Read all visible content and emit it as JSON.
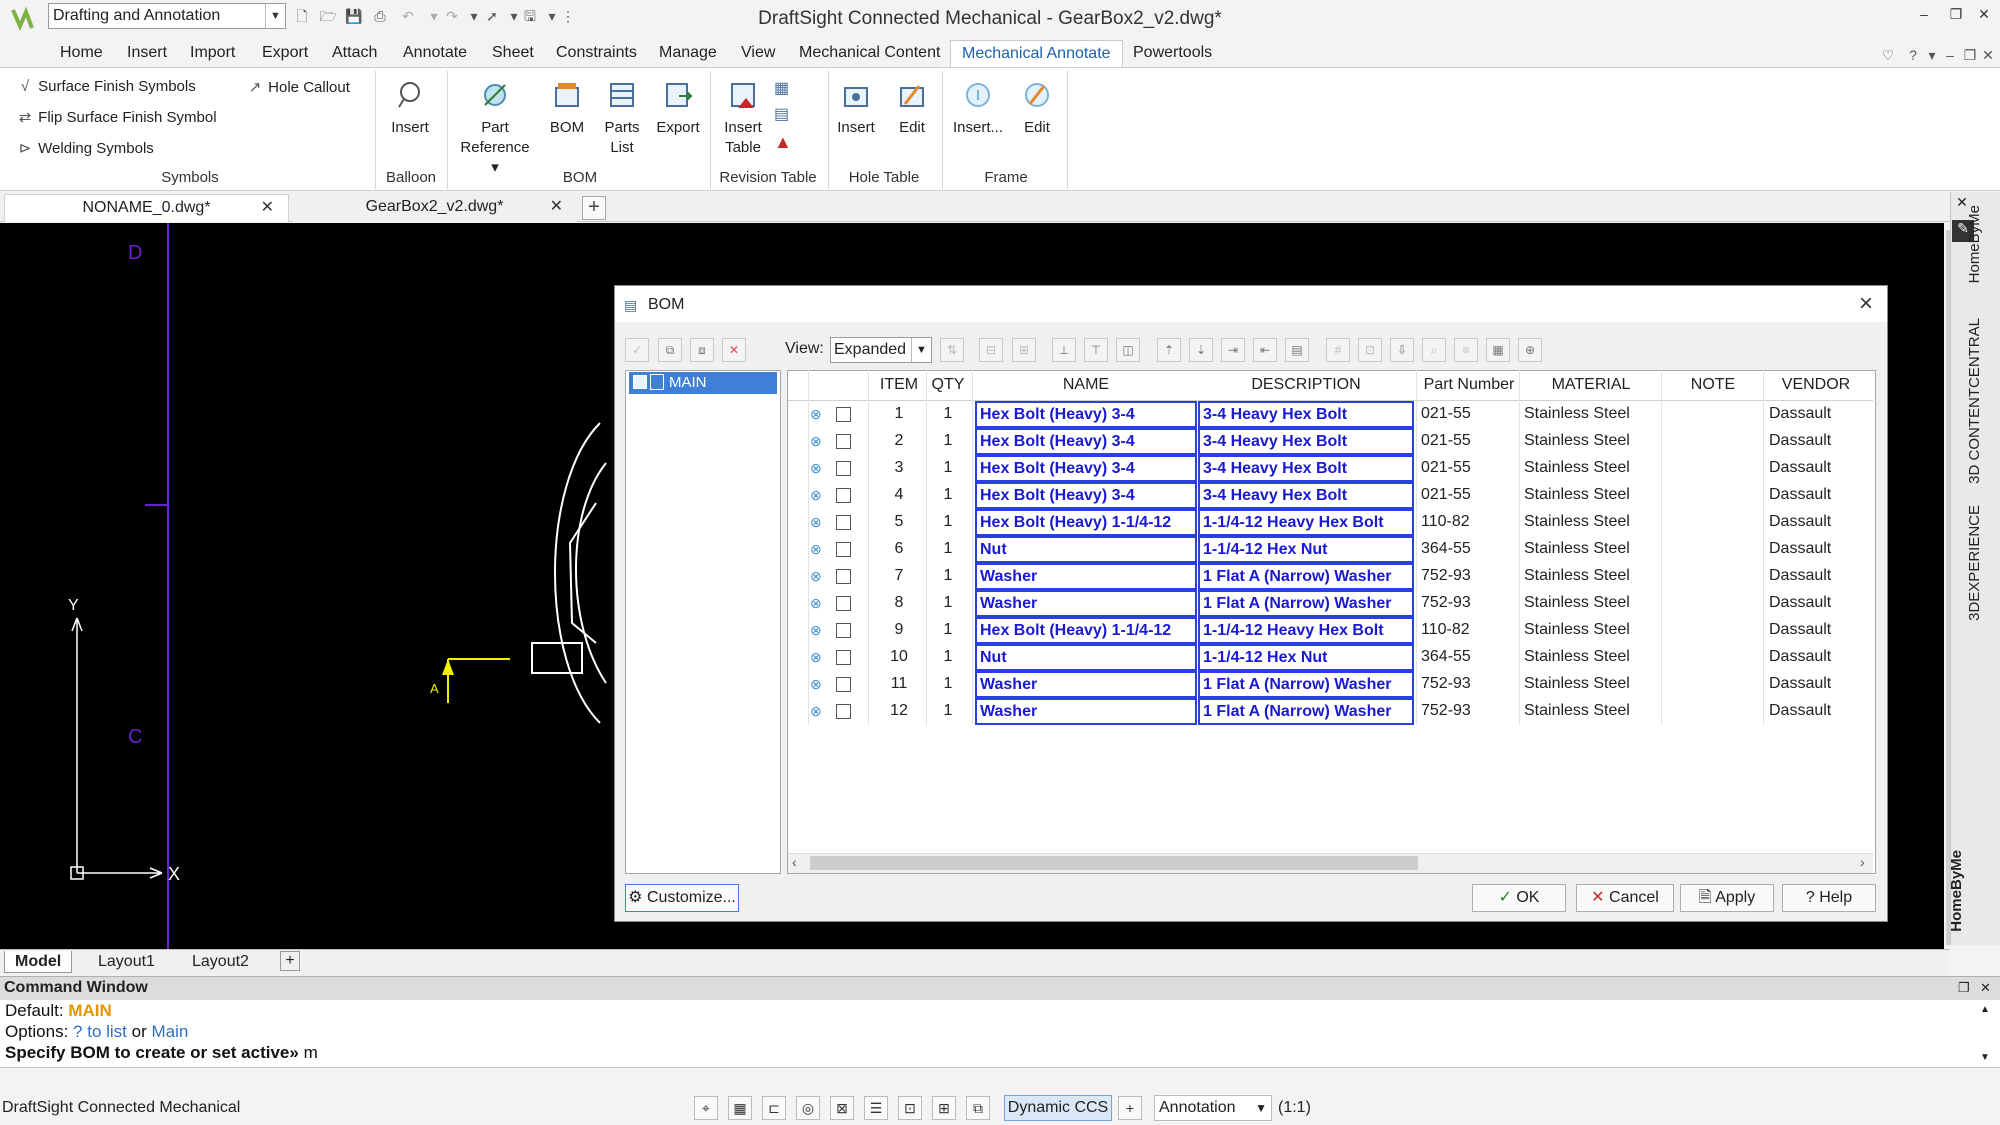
{
  "window": {
    "title": "DraftSight Connected Mechanical - GearBox2_v2.dwg*",
    "workspace": "Drafting and Annotation"
  },
  "menu": {
    "tabs": [
      "Home",
      "Insert",
      "Import",
      "Export",
      "Attach",
      "Annotate",
      "Sheet",
      "Constraints",
      "Manage",
      "View",
      "Mechanical Content",
      "Mechanical Annotate",
      "Powertools"
    ],
    "active": "Mechanical Annotate"
  },
  "ribbon": {
    "symbols": {
      "title": "Symbols",
      "surface_finish": "Surface Finish Symbols",
      "flip_surface": "Flip Surface Finish Symbol",
      "welding": "Welding Symbols",
      "hole_callout": "Hole Callout"
    },
    "balloon": {
      "title": "Balloon",
      "insert": "Insert"
    },
    "bom": {
      "title": "BOM",
      "part_reference_1": "Part",
      "part_reference_2": "Reference",
      "bom": "BOM",
      "parts_list_1": "Parts",
      "parts_list_2": "List",
      "export": "Export"
    },
    "revision": {
      "title": "Revision Table",
      "insert_1": "Insert",
      "insert_2": "Table"
    },
    "hole_table": {
      "title": "Hole Table",
      "insert": "Insert",
      "edit": "Edit"
    },
    "frame": {
      "title": "Frame",
      "insert": "Insert...",
      "edit": "Edit"
    }
  },
  "doc_tabs": [
    "NONAME_0.dwg*",
    "GearBox2_v2.dwg*"
  ],
  "drawing": {
    "label_d": "D",
    "label_c": "C",
    "label_a": "A",
    "axis_x": "X",
    "axis_y": "Y"
  },
  "side_tabs": [
    "HomeByMe",
    "3D CONTENTCENTRAL",
    "3DEXPERIENCE",
    "HomeByMe"
  ],
  "layout_tabs": [
    "Model",
    "Layout1",
    "Layout2"
  ],
  "command": {
    "title": "Command Window",
    "default_label": "Default:",
    "default_value": "MAIN",
    "options_label": "Options:",
    "options_link1": "? to list",
    "options_or": "or",
    "options_link2": "Main",
    "prompt": "Specify BOM to create or set active»",
    "input": "m"
  },
  "status": {
    "app": "DraftSight Connected Mechanical",
    "dynamic_ccs": "Dynamic CCS",
    "annotation": "Annotation",
    "scale": "(1:1)"
  },
  "bom_dialog": {
    "title": "BOM",
    "view_label": "View:",
    "view_value": "Expanded",
    "tree_root": "MAIN",
    "columns": [
      "ITEM",
      "QTY",
      "NAME",
      "DESCRIPTION",
      "Part Number",
      "MATERIAL",
      "NOTE",
      "VENDOR"
    ],
    "rows": [
      {
        "item": "1",
        "qty": "1",
        "name": "Hex Bolt (Heavy) 3-4",
        "desc": "3-4 Heavy Hex Bolt",
        "pn": "021-55",
        "material": "Stainless Steel",
        "note": "",
        "vendor": "Dassault"
      },
      {
        "item": "2",
        "qty": "1",
        "name": "Hex Bolt (Heavy) 3-4",
        "desc": "3-4 Heavy Hex Bolt",
        "pn": "021-55",
        "material": "Stainless Steel",
        "note": "",
        "vendor": "Dassault"
      },
      {
        "item": "3",
        "qty": "1",
        "name": "Hex Bolt (Heavy) 3-4",
        "desc": "3-4 Heavy Hex Bolt",
        "pn": "021-55",
        "material": "Stainless Steel",
        "note": "",
        "vendor": "Dassault"
      },
      {
        "item": "4",
        "qty": "1",
        "name": "Hex Bolt (Heavy) 3-4",
        "desc": "3-4 Heavy Hex Bolt",
        "pn": "021-55",
        "material": "Stainless Steel",
        "note": "",
        "vendor": "Dassault"
      },
      {
        "item": "5",
        "qty": "1",
        "name": "Hex Bolt (Heavy) 1-1/4-12",
        "desc": "1-1/4-12 Heavy Hex Bolt",
        "pn": "110-82",
        "material": "Stainless Steel",
        "note": "",
        "vendor": "Dassault"
      },
      {
        "item": "6",
        "qty": "1",
        "name": "Nut",
        "desc": "1-1/4-12 Hex Nut",
        "pn": "364-55",
        "material": "Stainless Steel",
        "note": "",
        "vendor": "Dassault"
      },
      {
        "item": "7",
        "qty": "1",
        "name": "Washer",
        "desc": "1 Flat A (Narrow) Washer",
        "pn": "752-93",
        "material": "Stainless Steel",
        "note": "",
        "vendor": "Dassault"
      },
      {
        "item": "8",
        "qty": "1",
        "name": "Washer",
        "desc": "1 Flat A (Narrow) Washer",
        "pn": "752-93",
        "material": "Stainless Steel",
        "note": "",
        "vendor": "Dassault"
      },
      {
        "item": "9",
        "qty": "1",
        "name": "Hex Bolt (Heavy) 1-1/4-12",
        "desc": "1-1/4-12 Heavy Hex Bolt",
        "pn": "110-82",
        "material": "Stainless Steel",
        "note": "",
        "vendor": "Dassault"
      },
      {
        "item": "10",
        "qty": "1",
        "name": "Nut",
        "desc": "1-1/4-12 Hex Nut",
        "pn": "364-55",
        "material": "Stainless Steel",
        "note": "",
        "vendor": "Dassault"
      },
      {
        "item": "11",
        "qty": "1",
        "name": "Washer",
        "desc": "1 Flat A (Narrow) Washer",
        "pn": "752-93",
        "material": "Stainless Steel",
        "note": "",
        "vendor": "Dassault"
      },
      {
        "item": "12",
        "qty": "1",
        "name": "Washer",
        "desc": "1 Flat A (Narrow) Washer",
        "pn": "752-93",
        "material": "Stainless Steel",
        "note": "",
        "vendor": "Dassault"
      }
    ],
    "buttons": {
      "customize": "Customize...",
      "ok": "OK",
      "cancel": "Cancel",
      "apply": "Apply",
      "help": "Help"
    }
  }
}
